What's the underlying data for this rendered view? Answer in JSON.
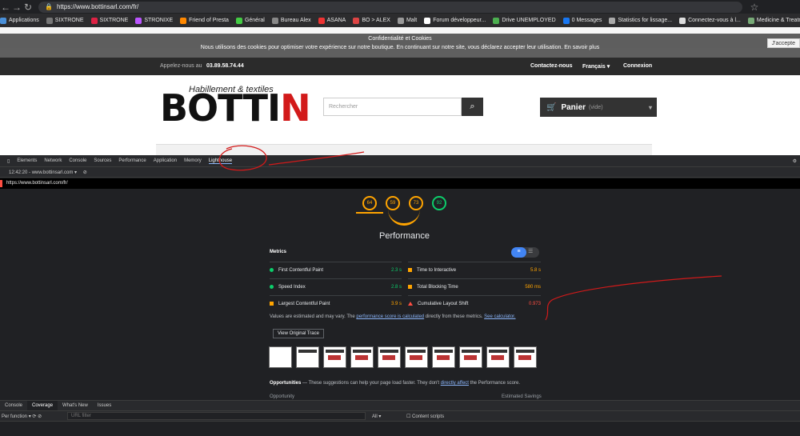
{
  "browser": {
    "url": "https://www.bottinsarl.com/fr/",
    "bookmarks": [
      "Applications",
      "SIXTRONE",
      "SIXTRONE",
      "STRONIXE",
      "Friend of Presta",
      "Général",
      "Bureau Alex",
      "ASANA",
      "BO > ALEX",
      "Malt",
      "Forum développeur...",
      "Drive UNEMPLOYED",
      "0 Messages",
      "Statistics for lissage...",
      "Connectez-vous à l...",
      "Medicine & Treatm..."
    ]
  },
  "site": {
    "cookie_title": "Confidentialité et Cookies",
    "cookie_text": "Nous utilisons des cookies pour optimiser votre expérience sur notre boutique. En continuant sur notre site, vous déclarez accepter leur utilisation. En savoir plus",
    "accept_label": "J'accepte",
    "phone_label": "Appelez-nous au",
    "phone": "03.89.58.74.44",
    "contact_label": "Contactez-nous",
    "language": "Français",
    "login_label": "Connexion",
    "logo_tagline": "Habillement & textiles",
    "logo_text_a": "BOTTI",
    "logo_text_b": "N",
    "search_placeholder": "Rechercher",
    "cart_label": "Panier",
    "cart_status": "(vide)"
  },
  "devtools": {
    "tabs": [
      "Elements",
      "Network",
      "Console",
      "Sources",
      "Performance",
      "Application",
      "Memory",
      "Lighthouse"
    ],
    "active_tab": "Lighthouse",
    "report_select": "12:42:20 - www.bottinsarl.com",
    "report_url": "https://www.bottinsarl.com/fr/",
    "drawer_tabs": [
      "Console",
      "Coverage",
      "What's New",
      "Issues"
    ],
    "coverage_mode": "Per function",
    "url_filter_placeholder": "URL filter",
    "type_select": "All",
    "content_scripts_label": "Content scripts"
  },
  "lighthouse": {
    "scores": [
      64,
      59,
      73,
      92
    ],
    "category_title": "Performance",
    "metrics_title": "Metrics",
    "metrics": [
      {
        "label": "First Contentful Paint",
        "value": "2.3 s",
        "status": "green"
      },
      {
        "label": "Time to Interactive",
        "value": "5.8 s",
        "status": "orange"
      },
      {
        "label": "Speed Index",
        "value": "2.8 s",
        "status": "green"
      },
      {
        "label": "Total Blocking Time",
        "value": "580 ms",
        "status": "orange"
      },
      {
        "label": "Largest Contentful Paint",
        "value": "3.9 s",
        "status": "orange"
      },
      {
        "label": "Cumulative Layout Shift",
        "value": "0.973",
        "status": "red"
      }
    ],
    "note_a": "Values are estimated and may vary. The",
    "note_link": "performance score is calculated",
    "note_b": "directly from these metrics.",
    "note_link2": "See calculator.",
    "trace_button": "View Original Trace",
    "opportunities_title": "Opportunities",
    "opportunities_a": "— These suggestions can help your page load faster. They don't",
    "opportunities_link": "directly affect",
    "opportunities_b": "the Performance score.",
    "opp_col": "Opportunity",
    "opp_savings": "Estimated Savings"
  },
  "colors": {
    "pass": "#0cce6b",
    "average": "#ffa400",
    "fail": "#ff4e42",
    "annotation": "#d21a1a"
  }
}
